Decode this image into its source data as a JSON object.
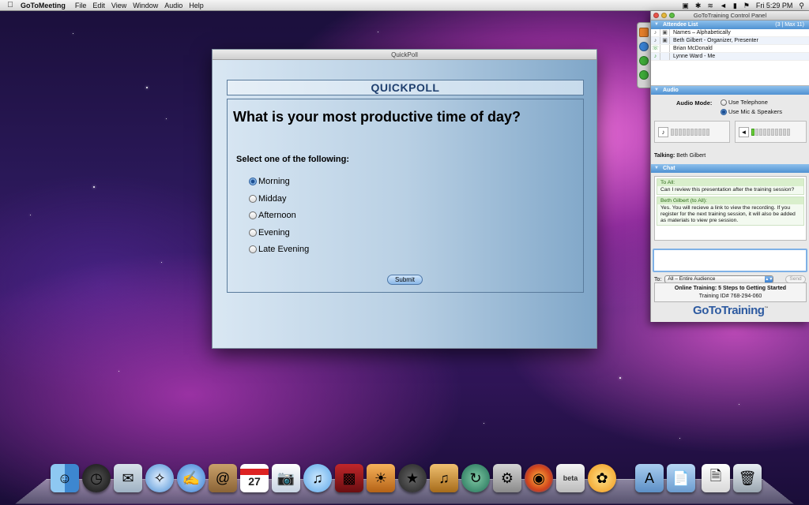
{
  "menubar": {
    "app_name": "GoToMeeting",
    "menus": [
      "File",
      "Edit",
      "View",
      "Window",
      "Audio",
      "Help"
    ],
    "clock": "Fri 5:29 PM"
  },
  "quickpoll": {
    "window_title": "QuickPoll",
    "header": "QUICKPOLL",
    "question": "What is your most productive time of day?",
    "instruction": "Select one of the following:",
    "options": [
      "Morning",
      "Midday",
      "Afternoon",
      "Evening",
      "Late Evening"
    ],
    "selected_option": "Morning",
    "submit_label": "Submit"
  },
  "control_panel": {
    "title": "GoToTraining Control Panel",
    "attendee_section": "Attendee List",
    "attendee_count": "(3 | Max 11)",
    "attendee_header": "Names – Alphabetically",
    "attendees": [
      "Beth Gilbert - Organizer, Presenter",
      "Brian McDonald",
      "Lynne Ward - Me"
    ],
    "audio_section": "Audio",
    "audio_mode_label": "Audio Mode:",
    "audio_options": [
      "Use Telephone",
      "Use Mic & Speakers"
    ],
    "audio_selected": "Use Mic & Speakers",
    "talking_label": "Talking:",
    "talking_name": "Beth Gilbert",
    "chat_section": "Chat",
    "chat_messages": [
      {
        "from": "To All:",
        "text": "Can I review this presentation after the training session?"
      },
      {
        "from": "Beth Gilbert (to All):",
        "text": "Yes. You will recieve a link to view the recording. If you register for the next training session, it will also be added as materials to view pre session."
      }
    ],
    "chat_to_label": "To:",
    "chat_to_value": "All – Entire Audience",
    "send_label": "Send",
    "session_title": "Online Training: 5 Steps to Getting Started",
    "training_id": "Training ID# 768-294-060",
    "logo": "GoToTraining",
    "logo_tm": "™"
  },
  "dock": {
    "icons": [
      "finder-icon",
      "dashboard-icon",
      "mail-icon",
      "safari-icon",
      "ichat-icon",
      "address-book-icon",
      "ical-icon",
      "preview-icon",
      "itunes-icon",
      "photo-booth-icon",
      "iphoto-icon",
      "imovie-icon",
      "garageband-icon",
      "time-machine-icon",
      "system-preferences-icon",
      "firefox-icon",
      "beta-app-icon",
      "gotomeeting-icon",
      "applications-folder-icon",
      "documents-folder-icon",
      "file-icon",
      "trash-icon"
    ],
    "beta_badge": "beta",
    "ical_date": "27"
  }
}
